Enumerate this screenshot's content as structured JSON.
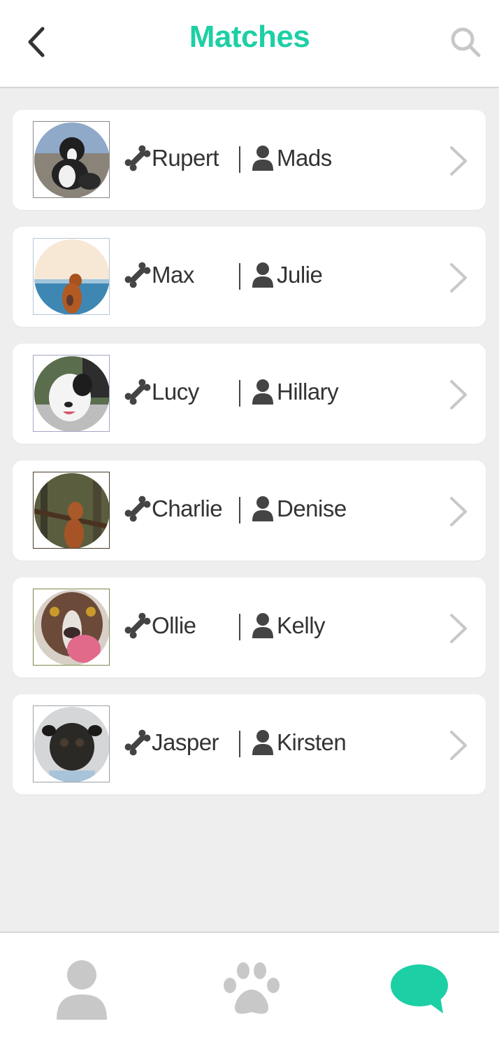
{
  "header": {
    "title": "Matches",
    "back_icon": "chevron-left-icon",
    "search_icon": "search-icon"
  },
  "colors": {
    "accent": "#1dcfa4",
    "text": "#333333",
    "icon_dark": "#444444",
    "icon_muted": "#c8c8c8",
    "background": "#eeeeee"
  },
  "matches": [
    {
      "dog": "Rupert",
      "owner": "Mads"
    },
    {
      "dog": "Max",
      "owner": "Julie"
    },
    {
      "dog": "Lucy",
      "owner": "Hillary"
    },
    {
      "dog": "Charlie",
      "owner": "Denise"
    },
    {
      "dog": "Ollie",
      "owner": "Kelly"
    },
    {
      "dog": "Jasper",
      "owner": "Kirsten"
    }
  ],
  "icons": {
    "dog": "bone-icon",
    "owner": "person-icon",
    "row_action": "chevron-right-icon"
  },
  "bottom_nav": [
    {
      "icon": "profile-icon",
      "active": false
    },
    {
      "icon": "paw-icon",
      "active": false
    },
    {
      "icon": "chat-bubble-icon",
      "active": true
    }
  ]
}
